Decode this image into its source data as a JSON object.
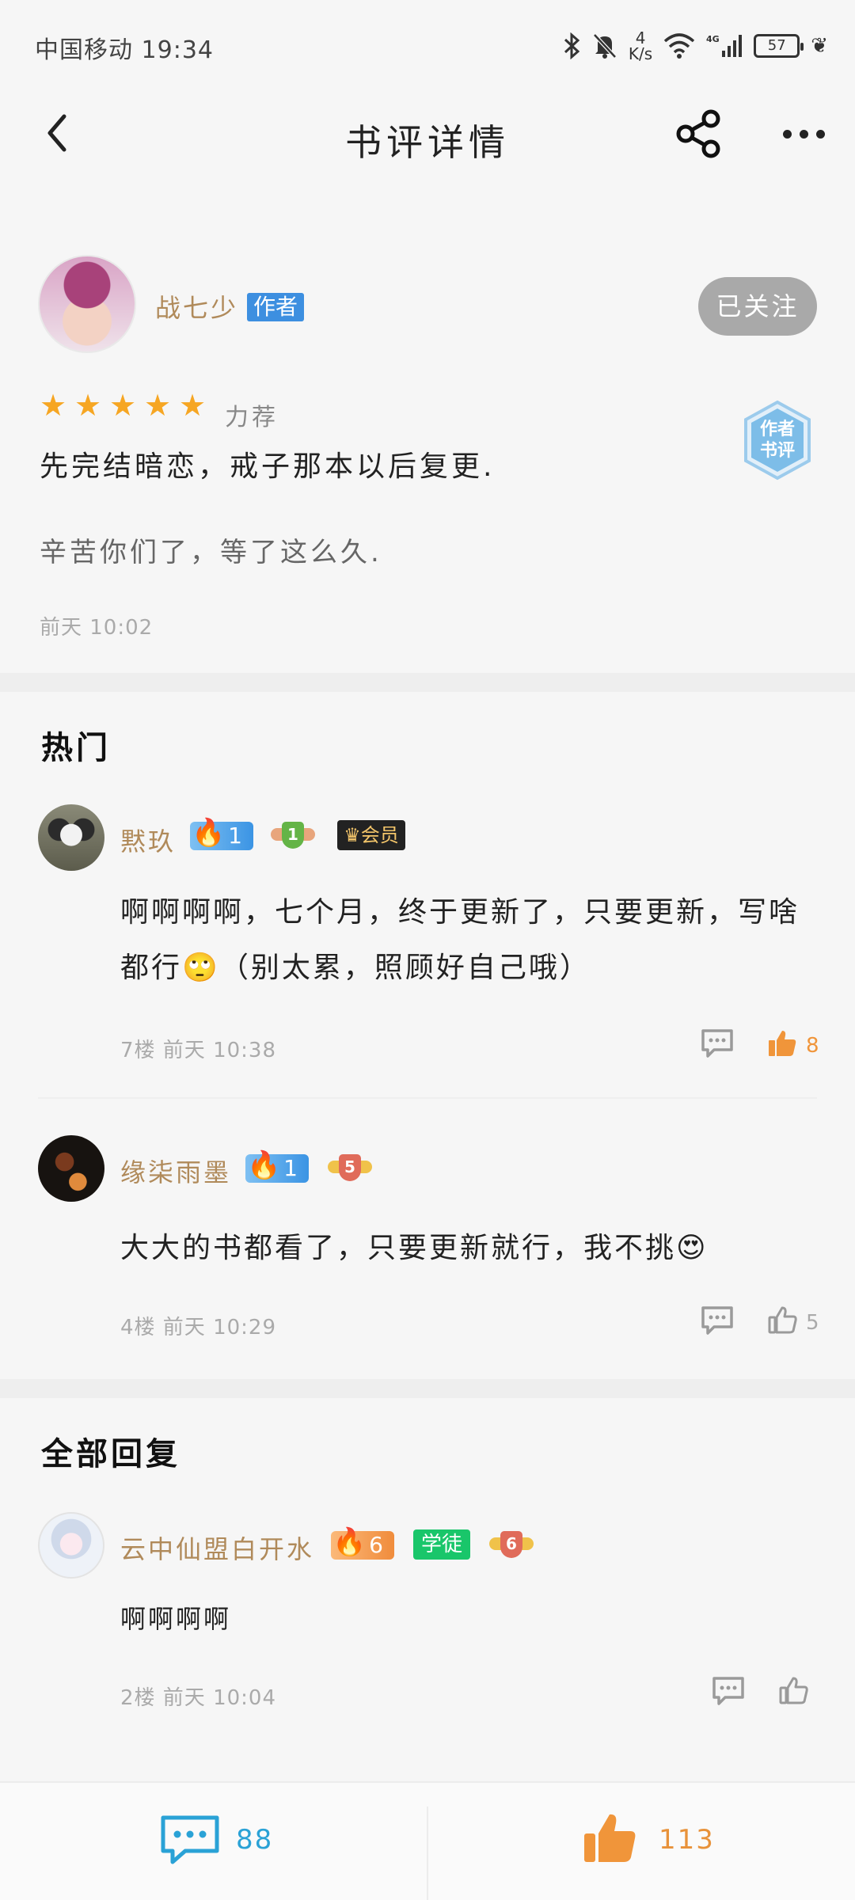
{
  "status_bar": {
    "carrier_time": "中国移动 19:34",
    "net_speed_value": "4",
    "net_speed_unit": "K/s",
    "battery": "57"
  },
  "header": {
    "title": "书评详情"
  },
  "review": {
    "author_name": "战七少",
    "author_badge": "作者",
    "follow_label": "已关注",
    "stars": 5,
    "rating_label": "力荐",
    "stamp_line1": "作者",
    "stamp_line2": "书评",
    "title": "先完结暗恋，戒子那本以后复更.",
    "body": "辛苦你们了，等了这么久.",
    "time": "前天 10:02"
  },
  "hot": {
    "heading": "热门",
    "comments": [
      {
        "name": "黙玖",
        "fire_level": "1",
        "level": "1",
        "vip_label": "会员",
        "text": "啊啊啊啊，七个月，终于更新了，只要更新，写啥都行🙄（别太累，照顾好自己哦）",
        "meta": "7楼 前天 10:38",
        "likes": "8",
        "liked": true
      },
      {
        "name": "缘柒雨墨",
        "fire_level": "1",
        "level": "5",
        "text": "大大的书都看了，只要更新就行，我不挑😍",
        "meta": "4楼 前天 10:29",
        "likes": "5",
        "liked": false
      }
    ]
  },
  "all_replies": {
    "heading": "全部回复",
    "comments": [
      {
        "name": "云中仙盟白开水",
        "fire_level": "6",
        "role_label": "学徒",
        "level": "6",
        "text": "啊啊啊啊",
        "meta": "2楼 前天 10:04",
        "likes": ""
      }
    ]
  },
  "bottom_bar": {
    "comment_count": "88",
    "like_count": "113"
  },
  "colors": {
    "accent_blue": "#2aa2d6",
    "like_orange": "#f0953a",
    "star": "#f6a623",
    "name_gold": "#b08a5a"
  }
}
